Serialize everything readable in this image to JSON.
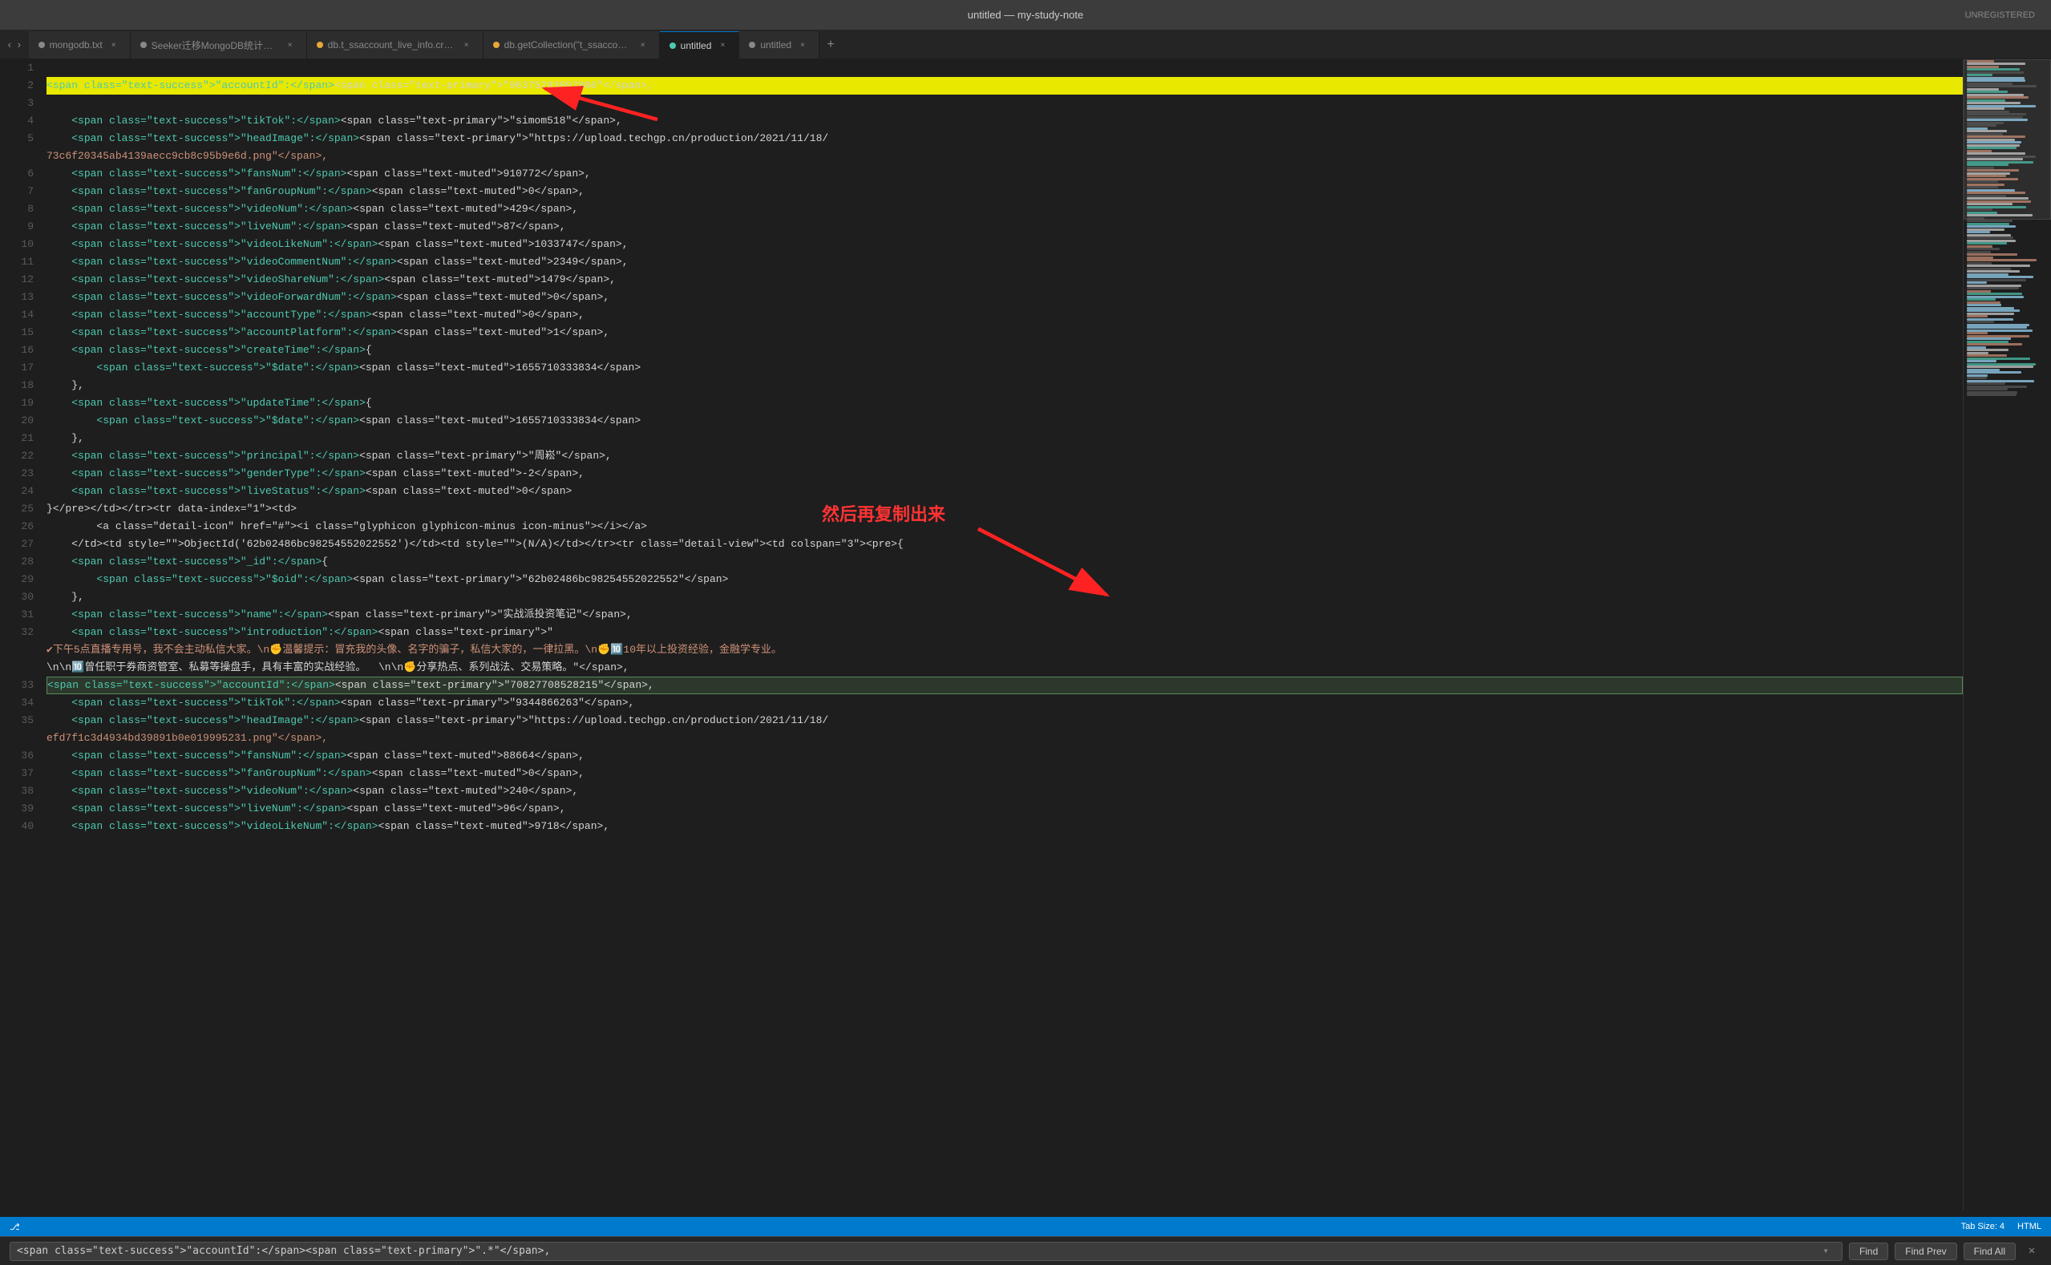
{
  "titleBar": {
    "title": "untitled — my-study-note",
    "unregistered": "UNREGISTERED"
  },
  "tabs": [
    {
      "id": "tab-mongodb",
      "label": "mongodb.txt",
      "active": false,
      "modified": false
    },
    {
      "id": "tab-seeker",
      "label": "Seeker迁移MongoDB统计（只有这些转mongo了）",
      "active": false,
      "modified": false
    },
    {
      "id": "tab-db-t-ss",
      "label": "db.t_ssaccount_live_info.createIndex({\"live_start_...",
      "active": false,
      "modified": true
    },
    {
      "id": "tab-db-get",
      "label": "db.getCollection(\"t_ssaccount_video_info\").find().",
      "active": false,
      "modified": true
    },
    {
      "id": "tab-untitled1",
      "label": "untitled",
      "active": true,
      "modified": true
    },
    {
      "id": "tab-untitled2",
      "label": "untitled",
      "active": false,
      "modified": false
    }
  ],
  "lines": [
    {
      "num": 1,
      "content": "",
      "type": "plain"
    },
    {
      "num": 2,
      "highlighted": true,
      "parts": [
        {
          "cls": "text-success",
          "text": "<span class=\"text-success\">\"accountId\":</span>"
        },
        {
          "cls": "text-plain",
          "text": "<span class=\"text-primary\">\"96375293097800\"</span>,"
        }
      ]
    },
    {
      "num": 3,
      "content": "",
      "type": "plain"
    },
    {
      "num": 4,
      "indent": "    ",
      "parts": [
        {
          "cls": "text-success",
          "text": "<span class=\"text-success\">\"tikTok\":</span>"
        },
        {
          "cls": "text-plain",
          "text": "<span class=\"text-primary\">\"simom518\"</span>,"
        }
      ]
    },
    {
      "num": 5,
      "indent": "    ",
      "parts": [
        {
          "cls": "text-success",
          "text": "<span class=\"text-success\">\"headImage\":</span>"
        },
        {
          "cls": "text-plain",
          "text": "<span class=\"text-primary\">\"https://upload.techgp.cn/production/2021/11/18/"
        }
      ]
    },
    {
      "num": 6,
      "indent": "",
      "content": "73c6f20345ab4139aecc9cb8c95b9e6d.png\"</span>,",
      "type": "text-primary",
      "extraIndent": "    "
    },
    {
      "num": 6,
      "num2": 6,
      "indent": "    ",
      "parts": [
        {
          "cls": "text-success",
          "text": "<span class=\"text-success\">\"fansNum\":</span>"
        },
        {
          "cls": "text-plain",
          "text": "<span class=\"text-muted\">910772</span>,"
        }
      ]
    },
    {
      "num": 7,
      "indent": "    ",
      "parts": [
        {
          "cls": "text-success",
          "text": "<span class=\"text-success\">\"fanGroupNum\":</span>"
        },
        {
          "cls": "text-plain",
          "text": "<span class=\"text-muted\">0</span>,"
        }
      ]
    },
    {
      "num": 8,
      "indent": "    ",
      "parts": [
        {
          "cls": "text-success",
          "text": "<span class=\"text-success\">\"videoNum\":</span>"
        },
        {
          "cls": "text-plain",
          "text": "<span class=\"text-muted\">429</span>,"
        }
      ]
    },
    {
      "num": 9,
      "indent": "    ",
      "parts": [
        {
          "cls": "text-success",
          "text": "<span class=\"text-success\">\"liveNum\":</span>"
        },
        {
          "cls": "text-plain",
          "text": "<span class=\"text-muted\">87</span>,"
        }
      ]
    },
    {
      "num": 10,
      "indent": "    ",
      "parts": [
        {
          "cls": "text-success",
          "text": "<span class=\"text-success\">\"videoLikeNum\":</span>"
        },
        {
          "cls": "text-plain",
          "text": "<span class=\"text-muted\">1033747</span>,"
        }
      ]
    },
    {
      "num": 11,
      "indent": "    ",
      "parts": [
        {
          "cls": "text-success",
          "text": "<span class=\"text-success\">\"videoCommentNum\":</span>"
        },
        {
          "cls": "text-plain",
          "text": "<span class=\"text-muted\">2349</span>,"
        }
      ]
    },
    {
      "num": 12,
      "indent": "    ",
      "parts": [
        {
          "cls": "text-success",
          "text": "<span class=\"text-success\">\"videoShareNum\":</span>"
        },
        {
          "cls": "text-plain",
          "text": "<span class=\"text-muted\">1479</span>,"
        }
      ]
    },
    {
      "num": 13,
      "indent": "    ",
      "parts": [
        {
          "cls": "text-success",
          "text": "<span class=\"text-success\">\"videoForwardNum\":</span>"
        },
        {
          "cls": "text-plain",
          "text": "<span class=\"text-muted\">0</span>,"
        }
      ]
    },
    {
      "num": 14,
      "indent": "    ",
      "parts": [
        {
          "cls": "text-success",
          "text": "<span class=\"text-success\">\"accountType\":</span>"
        },
        {
          "cls": "text-plain",
          "text": "<span class=\"text-muted\">0</span>,"
        }
      ]
    },
    {
      "num": 15,
      "indent": "    ",
      "parts": [
        {
          "cls": "text-success",
          "text": "<span class=\"text-success\">\"accountPlatform\":</span>"
        },
        {
          "cls": "text-plain",
          "text": "<span class=\"text-muted\">1</span>,"
        }
      ]
    },
    {
      "num": 16,
      "indent": "    ",
      "parts": [
        {
          "cls": "text-success",
          "text": "<span class=\"text-success\">\"createTime\":</span>"
        },
        {
          "cls": "text-plain",
          "text": "{"
        }
      ]
    },
    {
      "num": 17,
      "indent": "        ",
      "parts": [
        {
          "cls": "text-success",
          "text": "<span class=\"text-success\">\"$date\":</span>"
        },
        {
          "cls": "text-plain",
          "text": "<span class=\"text-muted\">1655710333834</span>"
        }
      ]
    },
    {
      "num": 18,
      "indent": "    ",
      "content": "},",
      "type": "plain"
    },
    {
      "num": 19,
      "indent": "    ",
      "parts": [
        {
          "cls": "text-success",
          "text": "<span class=\"text-success\">\"updateTime\":</span>"
        },
        {
          "cls": "text-plain",
          "text": "{"
        }
      ]
    },
    {
      "num": 20,
      "indent": "        ",
      "parts": [
        {
          "cls": "text-success",
          "text": "<span class=\"text-success\">\"$date\":</span>"
        },
        {
          "cls": "text-plain",
          "text": "<span class=\"text-muted\">1655710333834</span>"
        }
      ]
    },
    {
      "num": 21,
      "indent": "    ",
      "content": "},",
      "type": "plain"
    },
    {
      "num": 22,
      "indent": "    ",
      "parts": [
        {
          "cls": "text-success",
          "text": "<span class=\"text-success\">\"principal\":</span>"
        },
        {
          "cls": "text-plain",
          "text": "<span class=\"text-primary\">\"周崧\"</span>,"
        }
      ]
    },
    {
      "num": 23,
      "indent": "    ",
      "parts": [
        {
          "cls": "text-success",
          "text": "<span class=\"text-success\">\"genderType\":</span>"
        },
        {
          "cls": "text-plain",
          "text": "<span class=\"text-muted\">-2</span>,"
        }
      ]
    },
    {
      "num": 24,
      "indent": "    ",
      "parts": [
        {
          "cls": "text-success",
          "text": "<span class=\"text-success\">\"liveStatus\":</span>"
        },
        {
          "cls": "text-plain",
          "text": "<span class=\"text-muted\">0</span>"
        }
      ]
    },
    {
      "num": 25,
      "content": "}</pre></td></tr><tr data-index=\"1\"><td>",
      "type": "plain"
    },
    {
      "num": 26,
      "indent": "        ",
      "content": "<a class=\"detail-icon\" href=\"#\"><i class=\"glyphicon glyphicon-minus icon-minus\"></i></a>",
      "type": "plain"
    },
    {
      "num": 27,
      "indent": "    ",
      "content": "</td><td style=\"\">ObjectId('62b02486bc98254552022552')</td><td style=\"\">(N/A)</td></tr><tr class=\"detail-view\"><td colspan=\"3\"><pre>{",
      "type": "plain"
    },
    {
      "num": 28,
      "indent": "    ",
      "parts": [
        {
          "cls": "text-success",
          "text": "<span class=\"text-success\">\"_id\":</span>"
        },
        {
          "cls": "text-plain",
          "text": "{"
        }
      ]
    },
    {
      "num": 29,
      "indent": "        ",
      "parts": [
        {
          "cls": "text-success",
          "text": "<span class=\"text-success\">\"$oid\":</span>"
        },
        {
          "cls": "text-plain",
          "text": "<span class=\"text-primary\">\"62b02486bc98254552022552\"</span>"
        }
      ]
    },
    {
      "num": 30,
      "indent": "    ",
      "content": "},",
      "type": "plain"
    },
    {
      "num": 31,
      "indent": "    ",
      "parts": [
        {
          "cls": "text-success",
          "text": "<span class=\"text-success\">\"name\":</span>"
        },
        {
          "cls": "text-plain",
          "text": "<span class=\"text-primary\">\"实战派投资笔记\"</span>,"
        }
      ]
    },
    {
      "num": 32,
      "indent": "    ",
      "parts": [
        {
          "cls": "text-success",
          "text": "<span class=\"text-success\">\"introduction\":</span>"
        },
        {
          "cls": "text-plain",
          "text": "<span class=\"text-primary\">\""
        }
      ]
    },
    {
      "num": 32,
      "isIntroLine": true,
      "content": "✔下午5点直播专用号，我不会主动私信大家。\\n✊温馨提示：冒充我的头像、名字的骗子，私信大家的，一律拉黑。\\n✊🔟10年以上投资经验，金融学专业。",
      "type": "plain"
    },
    {
      "num": 32,
      "isIntroLine2": true,
      "content": "\\n\\n🔟曾任职于券商资管室、私募等操盘手，具有丰富的实战经验。  \\n\\n✊分享热点、系列战法、交易策略。\"</span>,",
      "type": "plain"
    },
    {
      "num": 33,
      "highlighted2": true,
      "parts": [
        {
          "cls": "text-success",
          "text": "<span class=\"text-success\">\"accountId\":</span>"
        },
        {
          "cls": "text-plain",
          "text": "<span class=\"text-primary\">\"70827708528215\"</span>,"
        }
      ]
    },
    {
      "num": 34,
      "indent": "    ",
      "parts": [
        {
          "cls": "text-success",
          "text": "<span class=\"text-success\">\"tikTok\":</span>"
        },
        {
          "cls": "text-plain",
          "text": "<span class=\"text-primary\">\"9344866263\"</span>,"
        }
      ]
    },
    {
      "num": 35,
      "indent": "    ",
      "parts": [
        {
          "cls": "text-success",
          "text": "<span class=\"text-success\">\"headImage\":</span>"
        },
        {
          "cls": "text-plain",
          "text": "<span class=\"text-primary\">\"https://upload.techgp.cn/production/2021/11/18/"
        }
      ]
    },
    {
      "num": 35,
      "contLine": true,
      "content": "efd7f1c3d4934bd39891b0e019995231.png\"</span>,",
      "type": "text-primary"
    },
    {
      "num": 36,
      "indent": "    ",
      "parts": [
        {
          "cls": "text-success",
          "text": "<span class=\"text-success\">\"fansNum\":</span>"
        },
        {
          "cls": "text-plain",
          "text": "<span class=\"text-muted\">88664</span>,"
        }
      ]
    },
    {
      "num": 37,
      "indent": "    ",
      "parts": [
        {
          "cls": "text-success",
          "text": "<span class=\"text-success\">\"fanGroupNum\":</span>"
        },
        {
          "cls": "text-plain",
          "text": "<span class=\"text-muted\">0</span>,"
        }
      ]
    },
    {
      "num": 38,
      "indent": "    ",
      "parts": [
        {
          "cls": "text-success",
          "text": "<span class=\"text-success\">\"videoNum\":</span>"
        },
        {
          "cls": "text-plain",
          "text": "<span class=\"text-muted\">240</span>,"
        }
      ]
    },
    {
      "num": 39,
      "indent": "    ",
      "parts": [
        {
          "cls": "text-success",
          "text": "<span class=\"text-success\">\"liveNum\":</span>"
        },
        {
          "cls": "text-plain",
          "text": "<span class=\"text-muted\">96</span>,"
        }
      ]
    },
    {
      "num": 40,
      "indent": "    ",
      "parts": [
        {
          "cls": "text-success",
          "text": "<span class=\"text-success\">\"videoLikeNum\":</span>"
        },
        {
          "cls": "text-plain",
          "text": "<span class=\"text-muted\">9718</span>,"
        }
      ]
    }
  ],
  "findBar": {
    "inputValue": "<span class=\"text-success\">\"accountId\":</span><span class=\"text-primary\">\".*\"</span>,",
    "findLabel": "Find",
    "findPrevLabel": "Find Prev",
    "findAllLabel": "Find All"
  },
  "statusBar": {
    "tabSize": "Tab Size: 4",
    "language": "HTML"
  },
  "annotations": {
    "text1": "然后再复制出来",
    "arrow1": "up-right",
    "arrow2": "down-right"
  }
}
